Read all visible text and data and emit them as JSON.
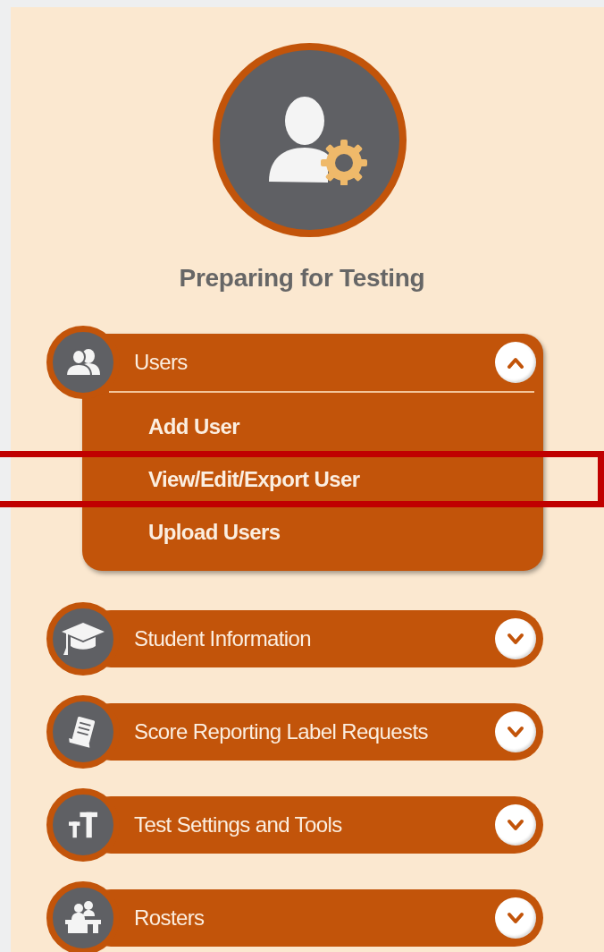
{
  "title": "Preparing for Testing",
  "sections": [
    {
      "label": "Users",
      "kind": "users",
      "expanded": true,
      "items": [
        {
          "label": "Add User",
          "highlighted": false
        },
        {
          "label": "View/Edit/Export User",
          "highlighted": true
        },
        {
          "label": "Upload Users",
          "highlighted": false
        }
      ]
    },
    {
      "label": "Student Information",
      "kind": "cap",
      "expanded": false
    },
    {
      "label": "Score Reporting Label Requests",
      "kind": "document",
      "expanded": false
    },
    {
      "label": "Test Settings and Tools",
      "kind": "textsize",
      "expanded": false
    },
    {
      "label": "Rosters",
      "kind": "classroom",
      "expanded": false
    }
  ]
}
